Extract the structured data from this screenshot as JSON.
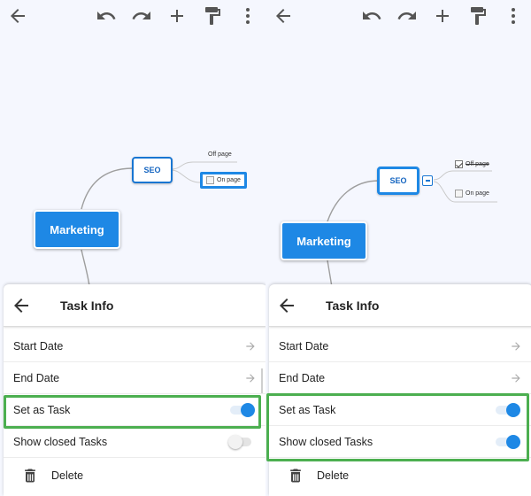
{
  "left_panel": {
    "toolbar": {
      "back_icon": "arrow-left-icon",
      "undo_icon": "undo-icon",
      "redo_icon": "redo-icon",
      "add_icon": "plus-icon",
      "format_icon": "paint-roller-icon",
      "more_icon": "more-vertical-icon"
    },
    "mindmap": {
      "root": "Marketing",
      "child": "SEO",
      "leaves": [
        {
          "label": "Off page",
          "checkbox": false,
          "checked": false
        },
        {
          "label": "On page",
          "checkbox": true,
          "checked": false,
          "selected": true
        }
      ]
    },
    "sheet": {
      "title": "Task Info",
      "rows": [
        {
          "label": "Start Date"
        },
        {
          "label": "End Date"
        },
        {
          "label": "Set as Task",
          "toggle": true
        },
        {
          "label": "Show closed Tasks",
          "toggle": false
        },
        {
          "label": "Delete"
        }
      ]
    }
  },
  "right_panel": {
    "mindmap": {
      "root": "Marketing",
      "child": "SEO",
      "leaves": [
        {
          "label": "Off page",
          "checkbox": true,
          "checked": true
        },
        {
          "label": "On page",
          "checkbox": true,
          "checked": false
        }
      ]
    },
    "sheet": {
      "title": "Task Info",
      "rows": [
        {
          "label": "Start Date"
        },
        {
          "label": "End Date"
        },
        {
          "label": "Set as Task",
          "toggle": true
        },
        {
          "label": "Show closed Tasks",
          "toggle": true
        },
        {
          "label": "Delete"
        }
      ]
    }
  },
  "colors": {
    "accent": "#1e88e5",
    "highlight": "#4caf50",
    "canvas_bg": "#f5f7fe"
  }
}
